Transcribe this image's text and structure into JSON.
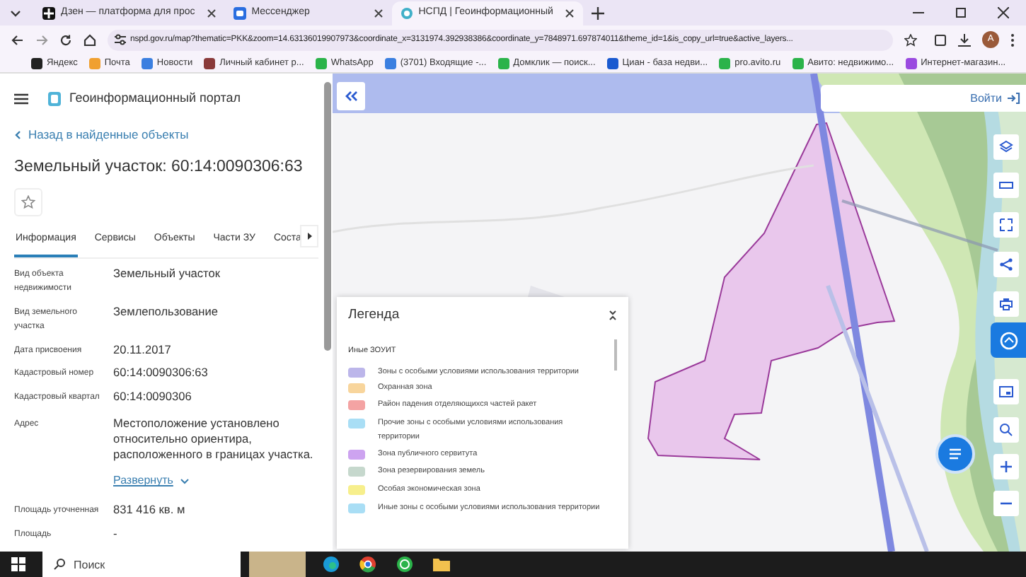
{
  "browser": {
    "tabs": [
      {
        "title": "Дзен — платформа для прос",
        "selected": false
      },
      {
        "title": "Мессенджер",
        "selected": false
      },
      {
        "title": "НСПД | Геоинформационный",
        "selected": true
      }
    ],
    "url": "nspd.gov.ru/map?thematic=PKK&zoom=14.63136019907973&coordinate_x=3131974.392938386&coordinate_y=7848971.697874011&theme_id=1&is_copy_url=true&active_layers...",
    "profile_initial": "A",
    "bookmarks": [
      {
        "label": "Яндекс",
        "color": "#222222"
      },
      {
        "label": "Почта",
        "color": "#f0a030"
      },
      {
        "label": "Новости",
        "color": "#3b7fe0"
      },
      {
        "label": "Личный кабинет р...",
        "color": "#8a3a3a"
      },
      {
        "label": "WhatsApp",
        "color": "#2bb34a"
      },
      {
        "label": "(3701) Входящие -...",
        "color": "#3b7fe0"
      },
      {
        "label": "Домклик — поиск...",
        "color": "#2bb34a"
      },
      {
        "label": "Циан - база недви...",
        "color": "#1a5ad0"
      },
      {
        "label": "pro.avito.ru",
        "color": "#2bb34a"
      },
      {
        "label": "Авито: недвижимо...",
        "color": "#2bb34a"
      },
      {
        "label": "Интернет-магазин...",
        "color": "#9a4ae0"
      }
    ]
  },
  "panel": {
    "app_title": "Геоинформационный портал",
    "back_link": "Назад в найденные объекты",
    "title": "Земельный участок: 60:14:0090306:63",
    "tabs": [
      {
        "label": "Информация",
        "selected": true
      },
      {
        "label": "Сервисы",
        "selected": false
      },
      {
        "label": "Объекты",
        "selected": false
      },
      {
        "label": "Части ЗУ",
        "selected": false
      },
      {
        "label": "Соста",
        "selected": false
      }
    ],
    "fields": [
      {
        "label": "Вид объекта недвижимости",
        "value": "Земельный участок"
      },
      {
        "label": "Вид земельного участка",
        "value": "Землепользование"
      },
      {
        "label": "Дата присвоения",
        "value": "20.11.2017"
      },
      {
        "label": "Кадастровый номер",
        "value": "60:14:0090306:63"
      },
      {
        "label": "Кадастровый квартал",
        "value": "60:14:0090306"
      },
      {
        "label": "Адрес",
        "value": "Местоположение установлено относительно ориентира, расположенного в границах участка.",
        "link": "Развернуть"
      },
      {
        "label": "Площадь уточненная",
        "value": "831 416 кв. м"
      },
      {
        "label": "Площадь",
        "value": "-"
      }
    ]
  },
  "map": {
    "login_button": "Войти",
    "legend": {
      "title": "Легенда",
      "group": "Иные ЗОУИТ",
      "items": [
        {
          "label": "Зоны с особыми условиями использования территории",
          "color": "#bcb6ea"
        },
        {
          "label": "Охранная зона",
          "color": "#f8d59c"
        },
        {
          "label": "Район падения отделяющихся частей ракет",
          "color": "#f4a3a3"
        },
        {
          "label": "Прочие зоны с особыми условиями использования территории",
          "color": "#a9def5"
        },
        {
          "label": "Зона публичного сервитута",
          "color": "#cda3f0"
        },
        {
          "label": "Зона резервирования земель",
          "color": "#c6d8cd"
        },
        {
          "label": "Особая экономическая зона",
          "color": "#f7ef8c"
        },
        {
          "label": "Иные зоны с особыми условиями использования территории",
          "color": "#a9def5"
        }
      ]
    }
  },
  "taskbar": {
    "search_placeholder": "Поиск"
  }
}
